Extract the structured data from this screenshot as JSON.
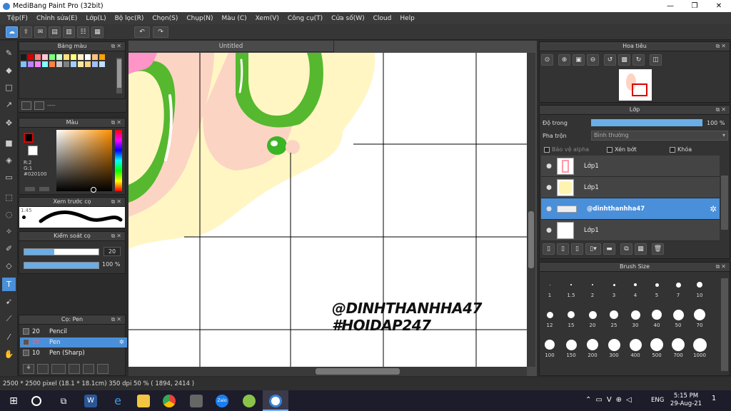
{
  "window": {
    "title": "MediBang Paint Pro (32bit)",
    "minimize": "—",
    "maximize": "❐",
    "close": "✕"
  },
  "menu": [
    "Tệp(F)",
    "Chỉnh sửa(E)",
    "Lớp(L)",
    "Bộ lọc(R)",
    "Chọn(S)",
    "Chụp(N)",
    "Màu (C)",
    "Xem(V)",
    "Công cụ(T)",
    "Cửa số(W)",
    "Cloud",
    "Help"
  ],
  "canvas_tab": "Untitled",
  "palette_panel": {
    "title": "Bảng màu",
    "footer": "----",
    "colors": [
      "#1a1a1a",
      "#d40000",
      "#ff8080",
      "#ffc8d4",
      "#80ff80",
      "#c8ffc8",
      "#ffe080",
      "#ffff80",
      "#fff0c8",
      "#ffffff",
      "#ffc080",
      "#ffa000",
      "#80c0ff",
      "#c080ff",
      "#ff80ff",
      "#80ffff",
      "#ff8040",
      "#c8c8c8",
      "#808080",
      "#a0d0ff",
      "#ffe8a0",
      "#ffd080",
      "#a0c0ff",
      "#c0e0ff"
    ]
  },
  "color_panel": {
    "title": "Màu",
    "r": "R:2",
    "g": "G:1",
    "hex": "#020100",
    "primary": "#020100"
  },
  "brush_preview": {
    "title": "Xem trước cọ",
    "size": "1.45"
  },
  "brush_control": {
    "title": "Kiểm soát cọ",
    "size": "20",
    "opacity": "100 %",
    "size_fill": 0.4,
    "opacity_fill": 1.0
  },
  "brush_list": {
    "title": "Cọ: Pen",
    "items": [
      {
        "size": "20",
        "name": "Pencil"
      },
      {
        "size": "20",
        "name": "Pen"
      },
      {
        "size": "10",
        "name": "Pen (Sharp)"
      }
    ]
  },
  "navigator": {
    "title": "Hoa tiêu"
  },
  "layer_panel": {
    "title": "Lớp",
    "opacity_label": "Độ trong",
    "opacity_value": "100 %",
    "opacity_fill": 1.0,
    "blend_label": "Pha trộn",
    "blend_value": "Bình thường",
    "protect_alpha": "Bảo vệ alpha",
    "clipping": "Xén bớt",
    "lock": "Khóa",
    "layers": [
      {
        "name": "Lớp1"
      },
      {
        "name": "Lớp1"
      },
      {
        "name": "@dinhthanhha47"
      },
      {
        "name": "Lớp1"
      }
    ]
  },
  "brush_size_panel": {
    "title": "Brush Size",
    "sizes": [
      "1",
      "1.5",
      "2",
      "3",
      "4",
      "5",
      "7",
      "10",
      "12",
      "15",
      "20",
      "25",
      "30",
      "40",
      "50",
      "70",
      "100",
      "150",
      "200",
      "300",
      "400",
      "500",
      "700",
      "1000"
    ]
  },
  "watermark": {
    "line1": "@DINHTHANHHA47",
    "line2": "#HOIDAP247"
  },
  "status": "2500 * 2500 pixel   (18.1 * 18.1cm)   350 dpi   50 %   ( 1894, 2414 )",
  "taskbar": {
    "lang": "ENG",
    "time": "5:15 PM",
    "date": "29-Aug-21",
    "notifications": "1"
  }
}
